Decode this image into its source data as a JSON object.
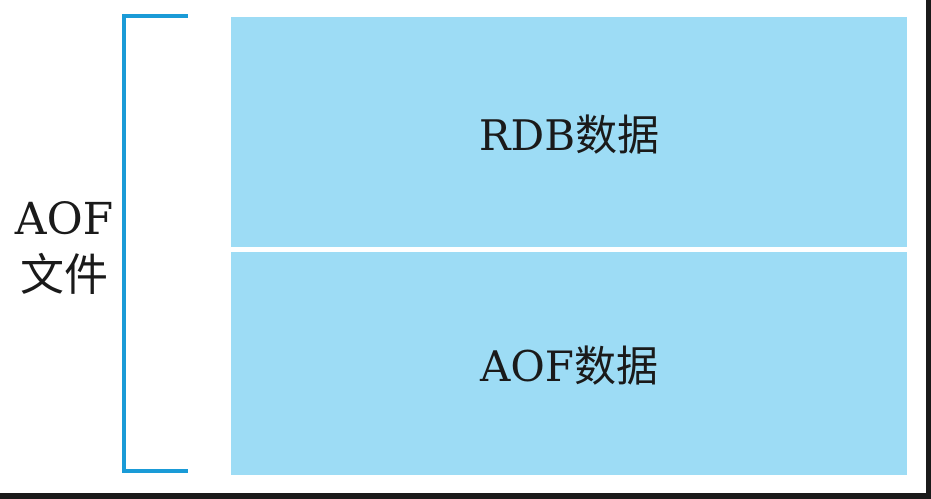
{
  "file_label": {
    "line1": "AOF",
    "line2": "文件"
  },
  "blocks": {
    "rdb": "RDB数据",
    "aof": "AOF数据"
  },
  "colors": {
    "bracket": "#1a9bd7",
    "block_fill": "#9ddcf5",
    "text": "#1a1a1a"
  }
}
